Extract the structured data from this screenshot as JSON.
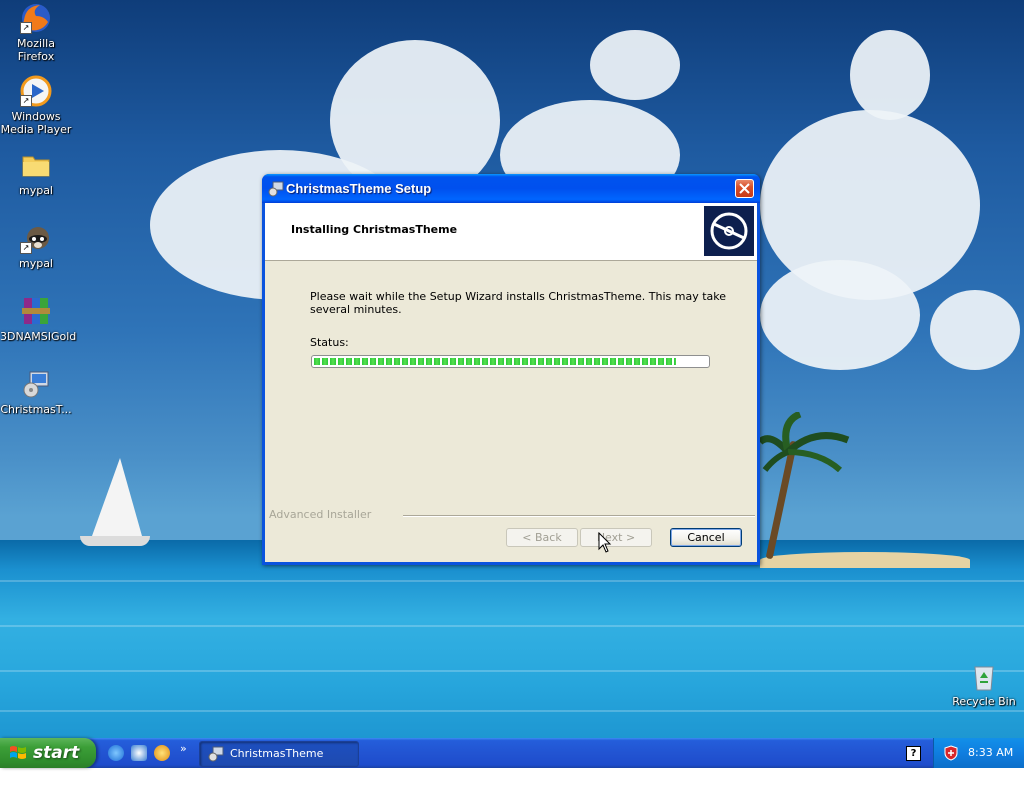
{
  "desktop": {
    "icons": [
      {
        "label": "Mozilla Firefox",
        "icon": "firefox-icon"
      },
      {
        "label": "Windows Media Player",
        "icon": "media-player-icon"
      },
      {
        "label": "mypal",
        "icon": "folder-icon"
      },
      {
        "label": "mypal",
        "icon": "mypal-raccoon-icon"
      },
      {
        "label": "3DNAMSIGold",
        "icon": "winrar-archive-icon"
      },
      {
        "label": "ChristmasT...",
        "icon": "installer-package-icon"
      },
      {
        "label": "Recycle Bin",
        "icon": "recycle-bin-icon"
      }
    ]
  },
  "dialog": {
    "title": "ChristmasTheme Setup",
    "heading": "Installing ChristmasTheme",
    "message": "Please wait while the Setup Wizard installs ChristmasTheme.  This may take several minutes.",
    "status_label": "Status:",
    "progress": 0.92,
    "brand": "Advanced Installer",
    "buttons": {
      "back": "< Back",
      "next": "Next >",
      "cancel": "Cancel"
    }
  },
  "taskbar": {
    "start_label": "start",
    "chevron": "»",
    "task_label": "ChristmasTheme Setup",
    "help_glyph": "?",
    "clock": "8:33 AM"
  },
  "colors": {
    "taskbar_blue": "#245edb",
    "start_green": "#3c9f38",
    "titlebar_blue": "#0053ee",
    "progress_green": "#2cc83a",
    "dialog_face": "#ece9d8"
  }
}
